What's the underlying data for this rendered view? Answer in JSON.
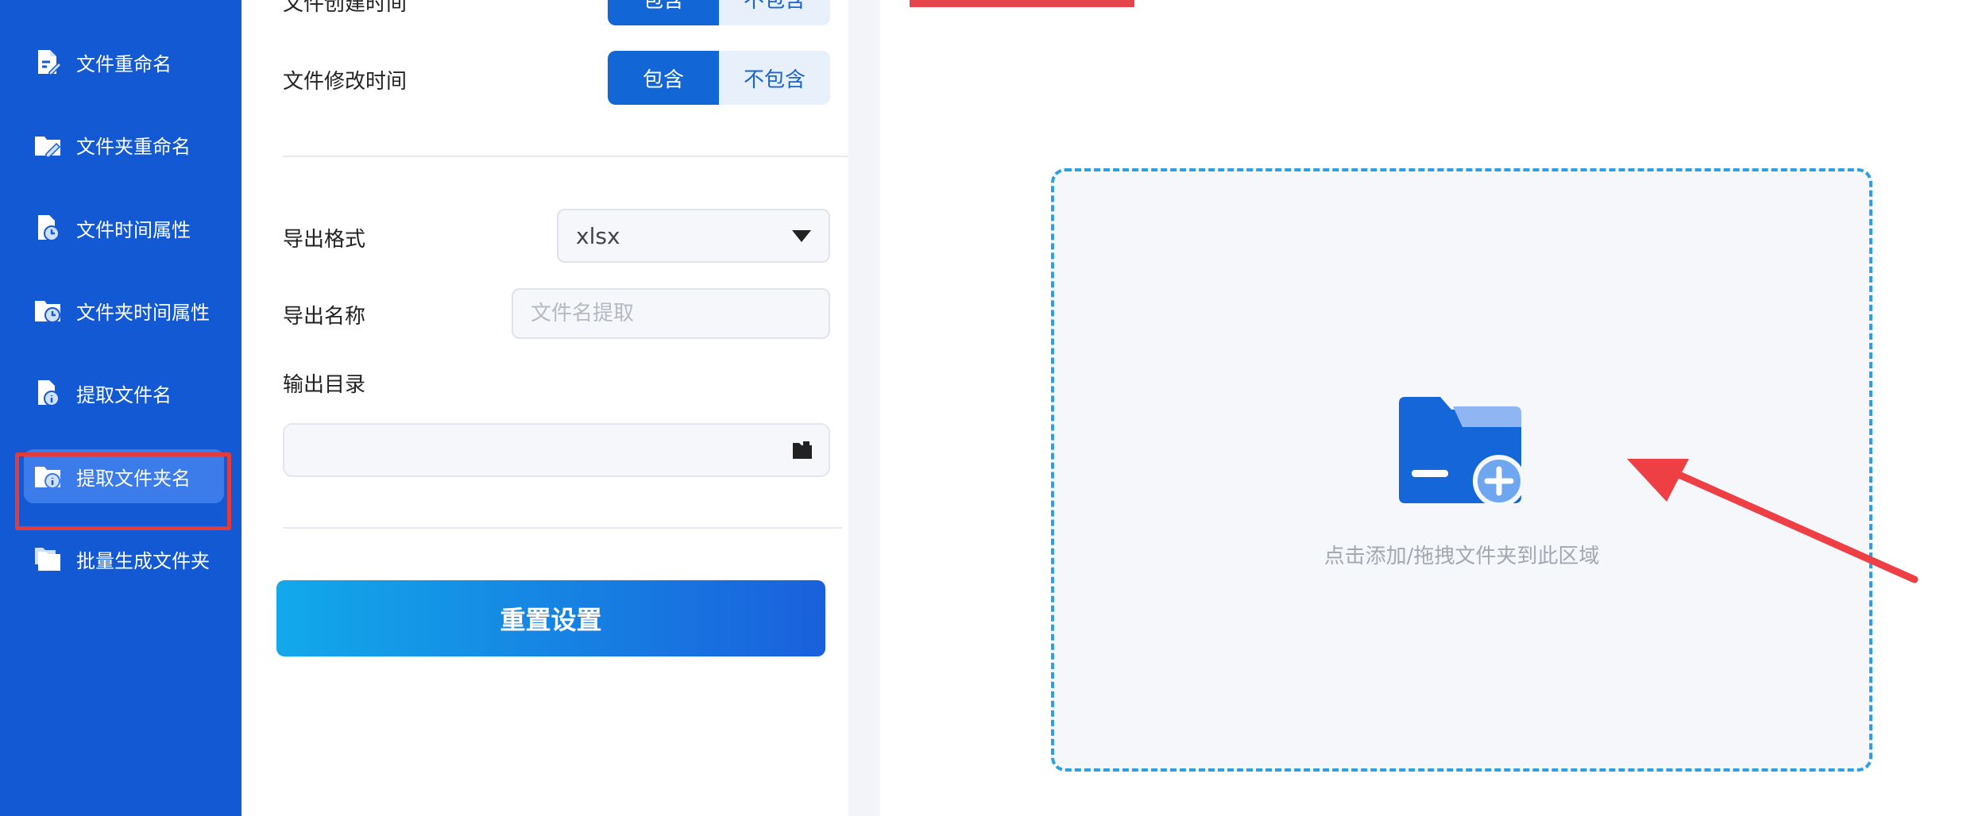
{
  "sidebar": {
    "items": [
      {
        "label": "文件重命名",
        "icon": "file-edit-icon"
      },
      {
        "label": "文件夹重命名",
        "icon": "folder-edit-icon"
      },
      {
        "label": "文件时间属性",
        "icon": "file-clock-icon"
      },
      {
        "label": "文件夹时间属性",
        "icon": "folder-clock-icon"
      },
      {
        "label": "提取文件名",
        "icon": "file-info-icon"
      },
      {
        "label": "提取文件夹名",
        "icon": "folder-info-icon",
        "active": true
      },
      {
        "label": "批量生成文件夹",
        "icon": "folders-icon"
      }
    ]
  },
  "settings": {
    "created_time_label": "文件创建时间",
    "modified_time_label": "文件修改时间",
    "include_label": "包含",
    "exclude_label": "不包含",
    "export_format_label": "导出格式",
    "export_format_value": "xlsx",
    "export_name_label": "导出名称",
    "export_name_placeholder": "文件名提取",
    "output_dir_label": "输出目录",
    "output_dir_value": "",
    "reset_label": "重置设置"
  },
  "dropzone": {
    "text": "点击添加/拖拽文件夹到此区域"
  },
  "colors": {
    "sidebar_bg": "#1259d3",
    "accent": "#1366d6",
    "highlight_red": "#e23b3b",
    "dropzone_border": "#2e9fe0"
  }
}
